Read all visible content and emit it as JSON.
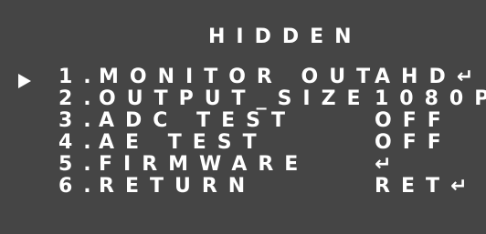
{
  "menu": {
    "title": "HIDDEN",
    "items": [
      {
        "number": "1.",
        "label": "MONITOR OUT",
        "value": "AHD↵"
      },
      {
        "number": "2.",
        "label": "OUTPUT_SIZE",
        "value": "1080P"
      },
      {
        "number": "3.",
        "label": "ADC TEST",
        "value": "OFF"
      },
      {
        "number": "4.",
        "label": "AE TEST",
        "value": "OFF"
      },
      {
        "number": "5.",
        "label": "FIRMWARE",
        "value": "↵"
      },
      {
        "number": "6.",
        "label": "RETURN",
        "value": "RET↵"
      }
    ]
  },
  "colors": {
    "background": "#454545",
    "text": "#ffffff"
  }
}
